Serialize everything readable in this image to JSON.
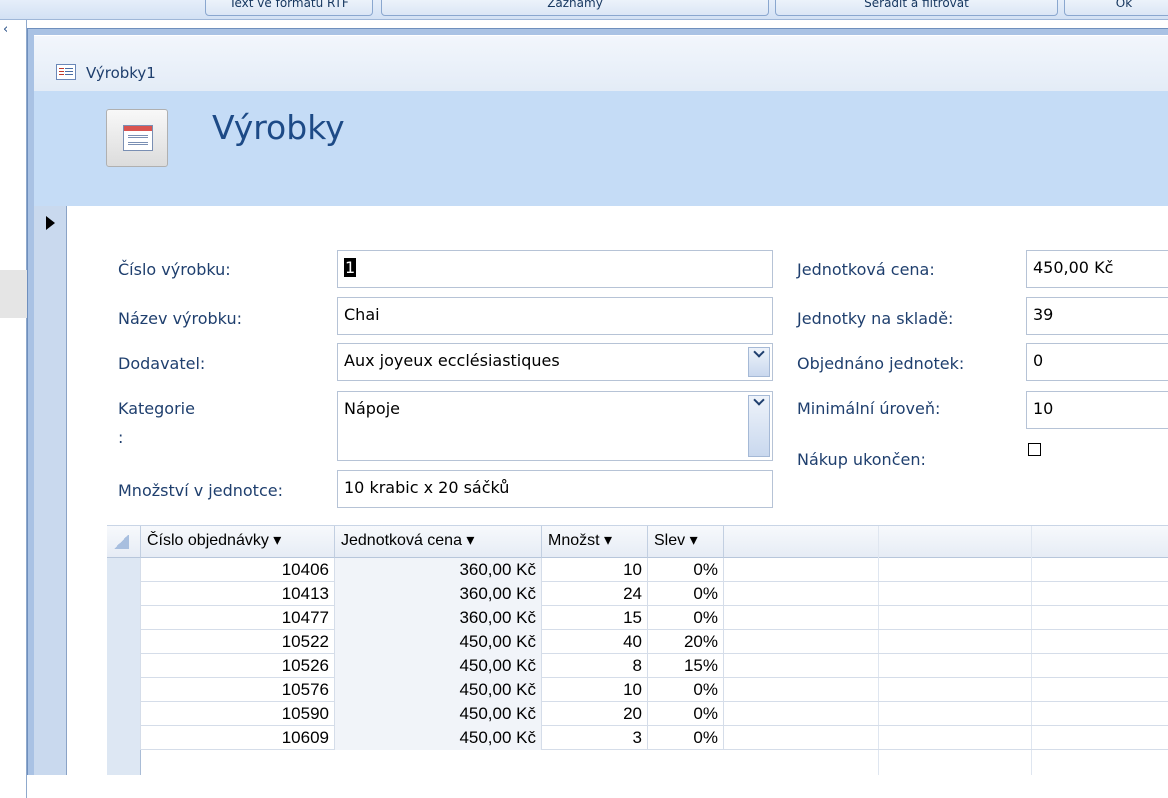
{
  "ribbon": {
    "buttons": [
      "Text ve formátu RTF",
      "Záznamy",
      "Seřadit a filtrovat",
      "Ok"
    ]
  },
  "nav": {
    "collapse_glyph": "‹"
  },
  "window": {
    "title": "Výrobky1"
  },
  "header": {
    "title": "Výrobky"
  },
  "fields": {
    "cislo_vyrobku": {
      "label": "Číslo výrobku:",
      "value": "1"
    },
    "nazev_vyrobku": {
      "label": "Název výrobku:",
      "value": "Chai"
    },
    "dodavatel": {
      "label": "Dodavatel:",
      "value": "Aux joyeux ecclésiastiques"
    },
    "kategorie": {
      "label": "Kategorie",
      "label2": ":",
      "value": "Nápoje"
    },
    "mnozstvi_v_jednotce": {
      "label": "Množství v jednotce:",
      "value": "10 krabic x 20 sáčků"
    },
    "jednotkova_cena": {
      "label": "Jednotková cena:",
      "value": "450,00 Kč"
    },
    "jednotky_na_sklade": {
      "label": "Jednotky na skladě:",
      "value": "39"
    },
    "objednano_jednotek": {
      "label": "Objednáno jednotek:",
      "value": "0"
    },
    "minimalni_uroven": {
      "label": "Minimální úroveň:",
      "value": "10"
    },
    "nakup_ukoncen": {
      "label": "Nákup ukončen:",
      "checked": false
    }
  },
  "subform": {
    "columns": [
      "Číslo objednávky ▾",
      "Jednotková cena  ▾",
      "Množst ▾",
      "Slev ▾"
    ],
    "rows": [
      [
        "10406",
        "360,00 Kč",
        "10",
        "0%"
      ],
      [
        "10413",
        "360,00 Kč",
        "24",
        "0%"
      ],
      [
        "10477",
        "360,00 Kč",
        "15",
        "0%"
      ],
      [
        "10522",
        "450,00 Kč",
        "40",
        "20%"
      ],
      [
        "10526",
        "450,00 Kč",
        "8",
        "15%"
      ],
      [
        "10576",
        "450,00 Kč",
        "10",
        "0%"
      ],
      [
        "10590",
        "450,00 Kč",
        "20",
        "0%"
      ],
      [
        "10609",
        "450,00 Kč",
        "3",
        "0%"
      ]
    ]
  },
  "icons": [
    "form-icon",
    "record-selector-arrow-icon",
    "combo-dropdown-icon",
    "select-all-icon"
  ]
}
